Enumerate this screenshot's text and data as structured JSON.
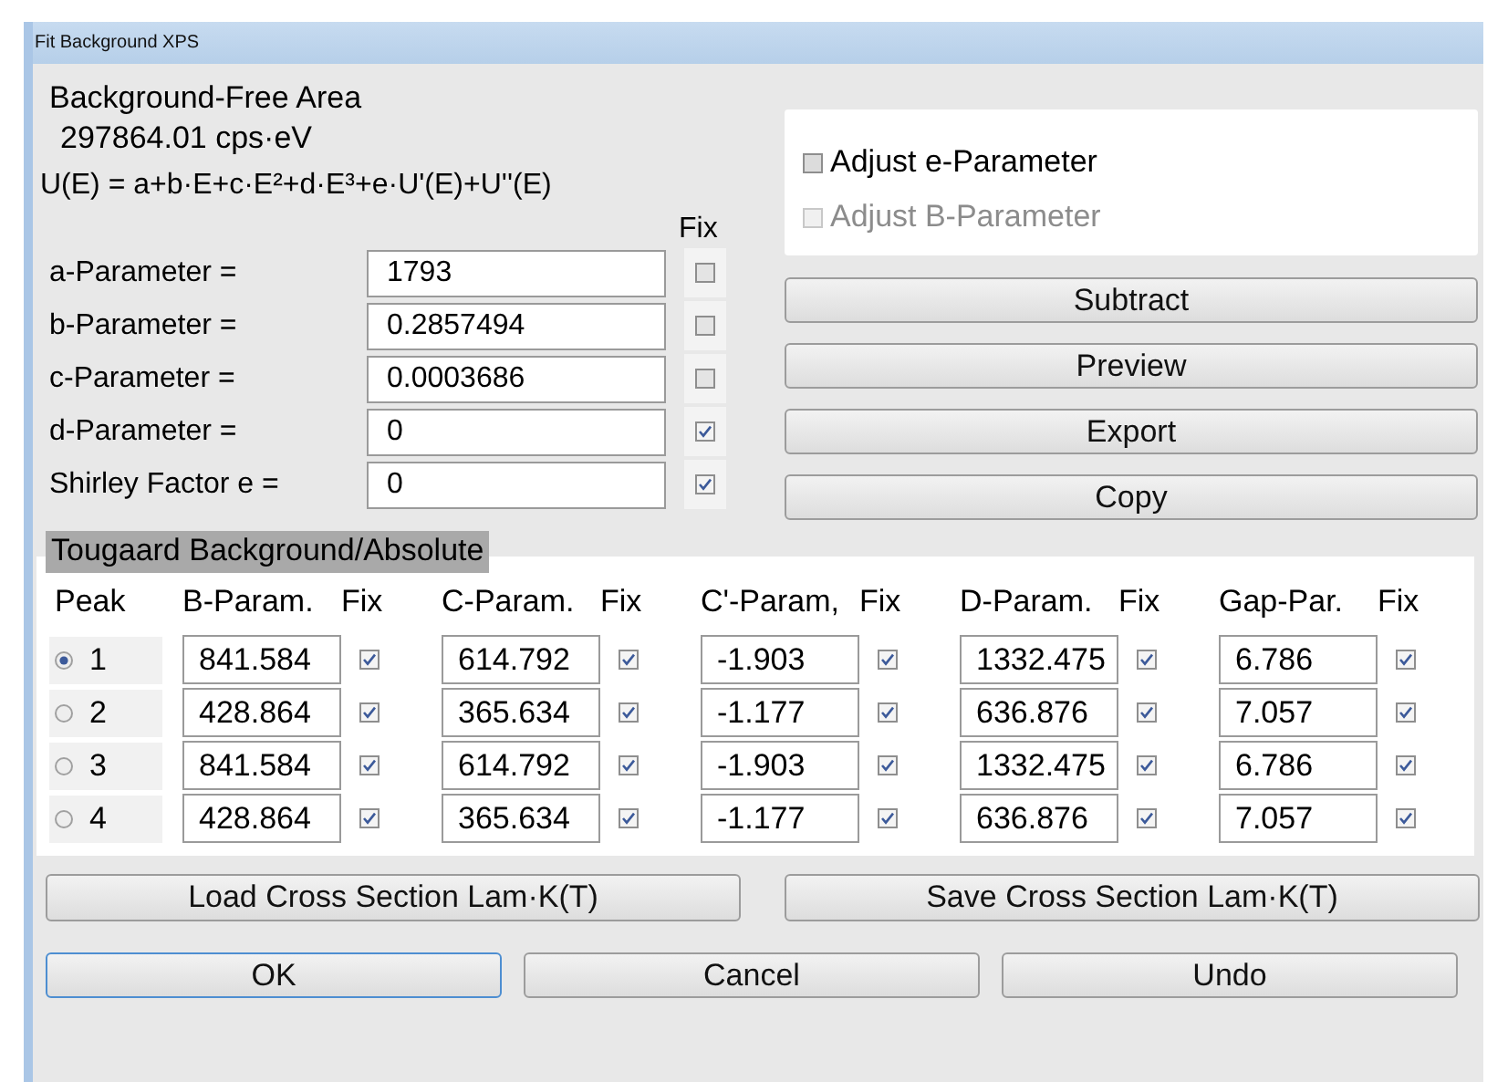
{
  "window": {
    "title": "Fit Background XPS"
  },
  "area": {
    "label": "Background-Free Area",
    "value": "297864.01 cps·eV"
  },
  "formula": "U(E) = a+b·E+c·E²+d·E³+e·U'(E)+U''(E)",
  "fix_header": "Fix",
  "parameters": [
    {
      "label": "a-Parameter =",
      "value": "1793",
      "fixed": false
    },
    {
      "label": "b-Parameter =",
      "value": "0.2857494",
      "fixed": false
    },
    {
      "label": "c-Parameter =",
      "value": "0.0003686",
      "fixed": false
    },
    {
      "label": "d-Parameter =",
      "value": "0",
      "fixed": true
    },
    {
      "label": "Shirley Factor e =",
      "value": "0",
      "fixed": true
    }
  ],
  "options": [
    {
      "label": "Adjust e-Parameter",
      "checked": false,
      "disabled": false
    },
    {
      "label": "Adjust B-Parameter",
      "checked": false,
      "disabled": true
    }
  ],
  "actions": [
    "Subtract",
    "Preview",
    "Export",
    "Copy"
  ],
  "tougaard": {
    "title": "Tougaard Background/Absolute",
    "columns": [
      "Peak",
      "B-Param.",
      "Fix",
      "C-Param.",
      "Fix",
      "C'-Param,",
      "Fix",
      "D-Param.",
      "Fix",
      "Gap-Par.",
      "Fix"
    ],
    "rows": [
      {
        "peak": "1",
        "selected": true,
        "values": [
          {
            "value": "841.584",
            "fixed": true
          },
          {
            "value": "614.792",
            "fixed": true
          },
          {
            "value": "-1.903",
            "fixed": true
          },
          {
            "value": "1332.475",
            "fixed": true
          },
          {
            "value": "6.786",
            "fixed": true
          }
        ]
      },
      {
        "peak": "2",
        "selected": false,
        "values": [
          {
            "value": "428.864",
            "fixed": true
          },
          {
            "value": "365.634",
            "fixed": true
          },
          {
            "value": "-1.177",
            "fixed": true
          },
          {
            "value": "636.876",
            "fixed": true
          },
          {
            "value": "7.057",
            "fixed": true
          }
        ]
      },
      {
        "peak": "3",
        "selected": false,
        "values": [
          {
            "value": "841.584",
            "fixed": true
          },
          {
            "value": "614.792",
            "fixed": true
          },
          {
            "value": "-1.903",
            "fixed": true
          },
          {
            "value": "1332.475",
            "fixed": true
          },
          {
            "value": "6.786",
            "fixed": true
          }
        ]
      },
      {
        "peak": "4",
        "selected": false,
        "values": [
          {
            "value": "428.864",
            "fixed": true
          },
          {
            "value": "365.634",
            "fixed": true
          },
          {
            "value": "-1.177",
            "fixed": true
          },
          {
            "value": "636.876",
            "fixed": true
          },
          {
            "value": "7.057",
            "fixed": true
          }
        ]
      }
    ]
  },
  "cross_section_buttons": [
    "Load Cross Section Lam·K(T)",
    "Save Cross Section Lam·K(T)"
  ],
  "dialog_buttons": [
    {
      "label": "OK",
      "default": true
    },
    {
      "label": "Cancel",
      "default": false
    },
    {
      "label": "Undo",
      "default": false
    }
  ]
}
